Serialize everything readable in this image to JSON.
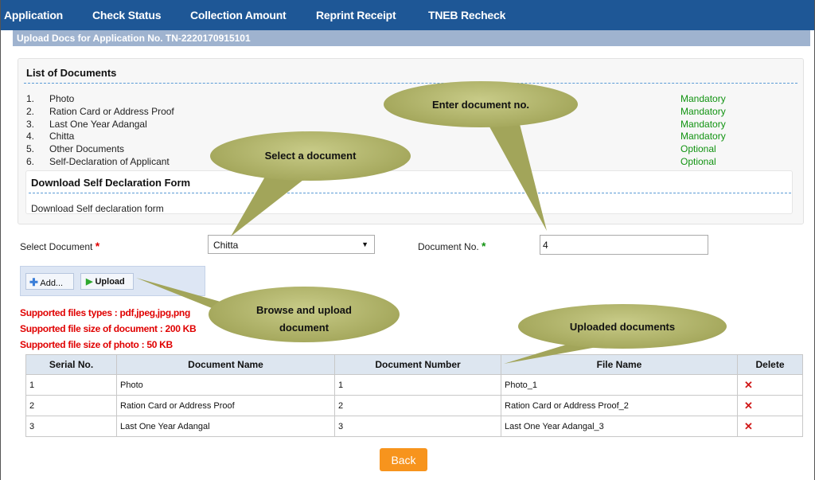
{
  "nav": [
    "Application",
    "Check Status",
    "Collection Amount",
    "Reprint Receipt",
    "TNEB Recheck"
  ],
  "subheader": "Upload Docs for Application No. TN-2220170915101",
  "documents": {
    "title": "List of Documents",
    "items": [
      {
        "num": "1.",
        "name": "Photo",
        "status": "Mandatory"
      },
      {
        "num": "2.",
        "name": "Ration Card or Address Proof",
        "status": "Mandatory"
      },
      {
        "num": "3.",
        "name": "Last One Year Adangal",
        "status": "Mandatory"
      },
      {
        "num": "4.",
        "name": "Chitta",
        "status": "Mandatory"
      },
      {
        "num": "5.",
        "name": "Other Documents",
        "status": "Optional"
      },
      {
        "num": "6.",
        "name": "Self-Declaration of Applicant",
        "status": "Optional"
      }
    ]
  },
  "download": {
    "title": "Download Self Declaration Form",
    "link": "Download Self declaration form"
  },
  "form": {
    "select_label": "Select Document",
    "select_value": "Chitta",
    "docno_label": "Document No.",
    "docno_value": "4",
    "required_mark": "*"
  },
  "upload": {
    "add_label": "Add...",
    "upload_label": "Upload"
  },
  "info": [
    "Supported files types : pdf,jpeg,jpg,png",
    "Supported file size of document : 200 KB",
    "Supported file size of photo : 50 KB"
  ],
  "table": {
    "headers": [
      "Serial No.",
      "Document Name",
      "Document Number",
      "File Name",
      "Delete"
    ],
    "rows": [
      [
        "1",
        "Photo",
        "1",
        "Photo_1"
      ],
      [
        "2",
        "Ration Card or Address Proof",
        "2",
        "Ration Card or Address Proof_2"
      ],
      [
        "3",
        "Last One Year Adangal",
        "3",
        "Last One Year Adangal_3"
      ]
    ],
    "delete_glyph": "✕"
  },
  "back_label": "Back",
  "callouts": {
    "enter_doc_no": "Enter document no.",
    "select_doc": "Select a document",
    "browse_upload_1": "Browse and upload",
    "browse_upload_2": "document",
    "uploaded_docs": "Uploaded documents"
  },
  "colors": {
    "nav_bg": "#1e5796",
    "subheader_bg": "#9fb3cf",
    "mandatory": "#119311",
    "info_red": "#e00000",
    "back_button": "#f7941d"
  }
}
